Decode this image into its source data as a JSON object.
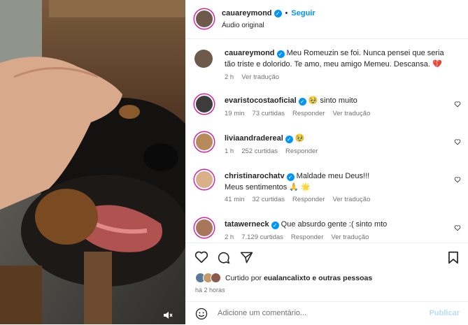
{
  "post": {
    "author": "cauareymond",
    "follow_label": "Seguir",
    "audio": "Áudio original",
    "caption_line1": "Meu Romeuzin se foi. Nunca pensei que seria",
    "caption_line2": "tão triste e dolorido. Te amo, meu amigo Memeu. Descansa.",
    "caption_emoji": "💔",
    "caption_time": "2 h",
    "see_translation": "Ver tradução"
  },
  "comments": [
    {
      "user": "evaristocostaoficial",
      "text": "sinto muito",
      "emoji": "🥹",
      "time": "19 min",
      "likes": "73 curtidas",
      "reply": "Responder",
      "translate": "Ver tradução"
    },
    {
      "user": "liviaandradereal",
      "text": "",
      "emoji": "🥹",
      "time": "1 h",
      "likes": "252 curtidas",
      "reply": "Responder",
      "translate": ""
    },
    {
      "user": "christinarochatv",
      "text": "Maldade meu Deus!!!",
      "text2": "Meus sentimentos",
      "emoji2": "🙏 🌟",
      "time": "41 min",
      "likes": "32 curtidas",
      "reply": "Responder",
      "translate": "Ver tradução"
    },
    {
      "user": "tatawerneck",
      "text": "Que absurdo gente :( sinto mto",
      "emoji": "🥹",
      "time": "2 h",
      "likes": "7.129 curtidas",
      "reply": "Responder",
      "translate": "Ver tradução"
    }
  ],
  "liked_by": {
    "prefix": "Curtido por ",
    "user": "eualancalixto",
    "suffix": " e outras pessoas"
  },
  "post_time": "há 2 horas",
  "add_comment": {
    "placeholder": "Adicione um comentário...",
    "publish": "Publicar"
  },
  "colors": {
    "accent": "#0095f6",
    "text": "#262626",
    "muted": "#737373",
    "publish_disabled": "#b2dffc"
  }
}
